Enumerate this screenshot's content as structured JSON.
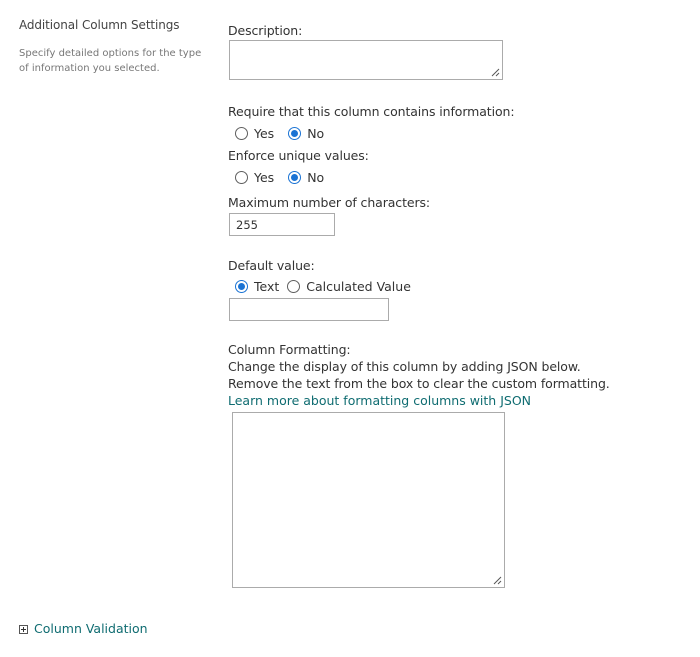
{
  "section": {
    "title": "Additional Column Settings",
    "description": "Specify detailed options for the type of information you selected."
  },
  "fields": {
    "description_label": "Description:",
    "description_value": "",
    "require_label": "Require that this column contains information:",
    "require_options": [
      "Yes",
      "No"
    ],
    "require_selected": "No",
    "unique_label": "Enforce unique values:",
    "unique_options": [
      "Yes",
      "No"
    ],
    "unique_selected": "No",
    "maxchars_label": "Maximum number of characters:",
    "maxchars_value": "255",
    "default_label": "Default value:",
    "default_options": [
      "Text",
      "Calculated Value"
    ],
    "default_selected": "Text",
    "default_value": "",
    "formatting_label": "Column Formatting:",
    "formatting_line1": "Change the display of this column by adding JSON below.",
    "formatting_line2": "Remove the text from the box to clear the custom formatting.",
    "formatting_link": "Learn more about formatting columns with JSON",
    "formatting_value": ""
  },
  "footer": {
    "validation_label": "Column Validation",
    "expand_icon": "plus-box-icon"
  },
  "colors": {
    "accent": "#1a73d4",
    "link": "#0f6c71",
    "border": "#ababab"
  }
}
